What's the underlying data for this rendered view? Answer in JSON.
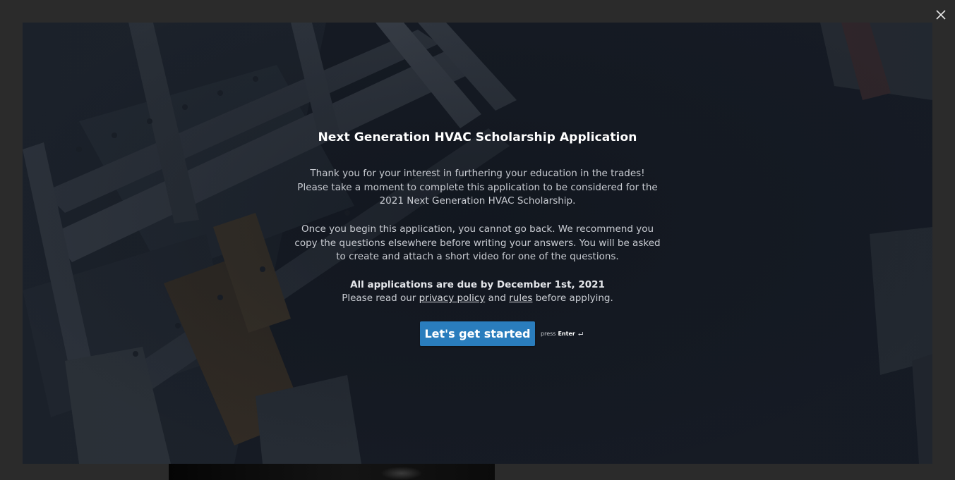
{
  "dialog": {
    "close_label": "×"
  },
  "welcome": {
    "title": "Next Generation HVAC Scholarship Application",
    "paragraph_1": "Thank you for your interest in furthering your education in the trades! Please take a moment to complete this application to be considered for the 2021 Next Generation HVAC Scholarship.",
    "paragraph_2": "Once you begin this application, you cannot go back. We recommend you copy the questions elsewhere before writing your answers. You will be asked to create and attach a short video for one of the questions.",
    "deadline": "All applications are due by December 1st, 2021",
    "read_prefix": "Please read our ",
    "privacy_link": "privacy policy",
    "read_and": " and ",
    "rules_link": "rules",
    "read_suffix": " before applying."
  },
  "start": {
    "button_label": "Let's get started",
    "hint_press": "press",
    "hint_key": "Enter"
  },
  "colors": {
    "accent": "#2a7dbd",
    "overlay": "#2b2b2b",
    "text_primary": "#ffffff",
    "text_secondary": "#c9ccd2"
  },
  "icons": {
    "close": "close-icon",
    "enter": "enter-key-icon"
  }
}
